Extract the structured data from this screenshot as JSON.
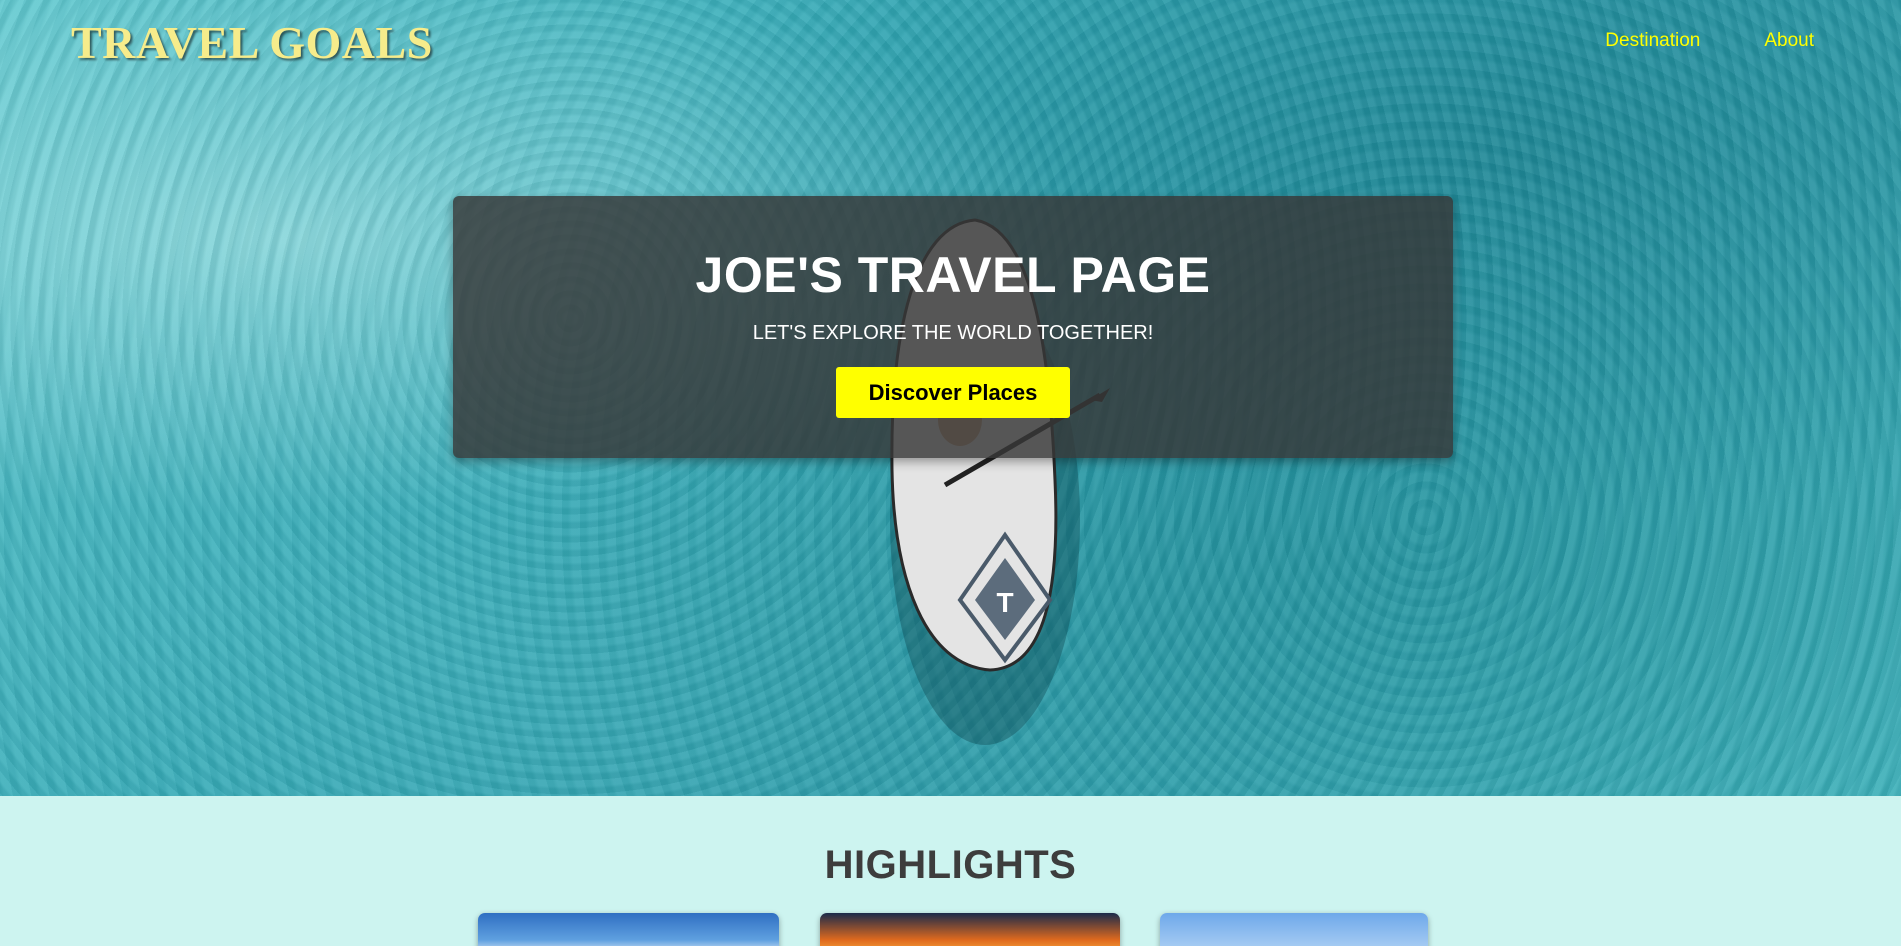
{
  "navbar": {
    "logo": "TRAVEL GOALS",
    "links": [
      {
        "label": "Destination"
      },
      {
        "label": "About"
      }
    ]
  },
  "hero": {
    "title": "JOE'S TRAVEL PAGE",
    "subtitle": "LET'S EXPLORE THE WORLD TOGETHER!",
    "cta_label": "Discover Places"
  },
  "highlights": {
    "title": "HIGHLIGHTS"
  },
  "colors": {
    "accent": "#ffff00",
    "logo": "#f6ec8b",
    "banner_bg": "#373737",
    "highlights_bg": "#cdf4f0",
    "heading": "#3d3d3d"
  }
}
